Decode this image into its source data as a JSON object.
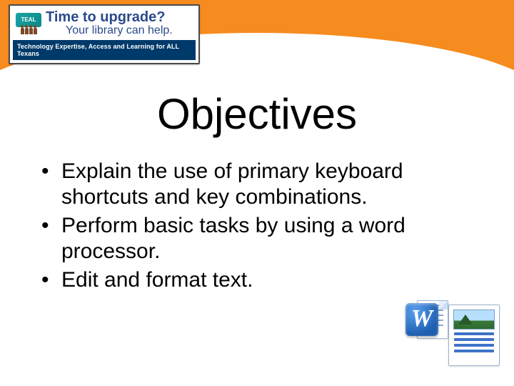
{
  "badge": {
    "teal_label": "TEAL",
    "line1": "Time to upgrade?",
    "line2": "Your library can help.",
    "footer": "Technology Expertise, Access and Learning for ALL Texans"
  },
  "title": "Objectives",
  "bullets": [
    "Explain the use of primary keyboard shortcuts and key combinations.",
    "Perform basic tasks by using a word processor.",
    "Edit and format text."
  ],
  "icons": {
    "word_letter": "W"
  }
}
